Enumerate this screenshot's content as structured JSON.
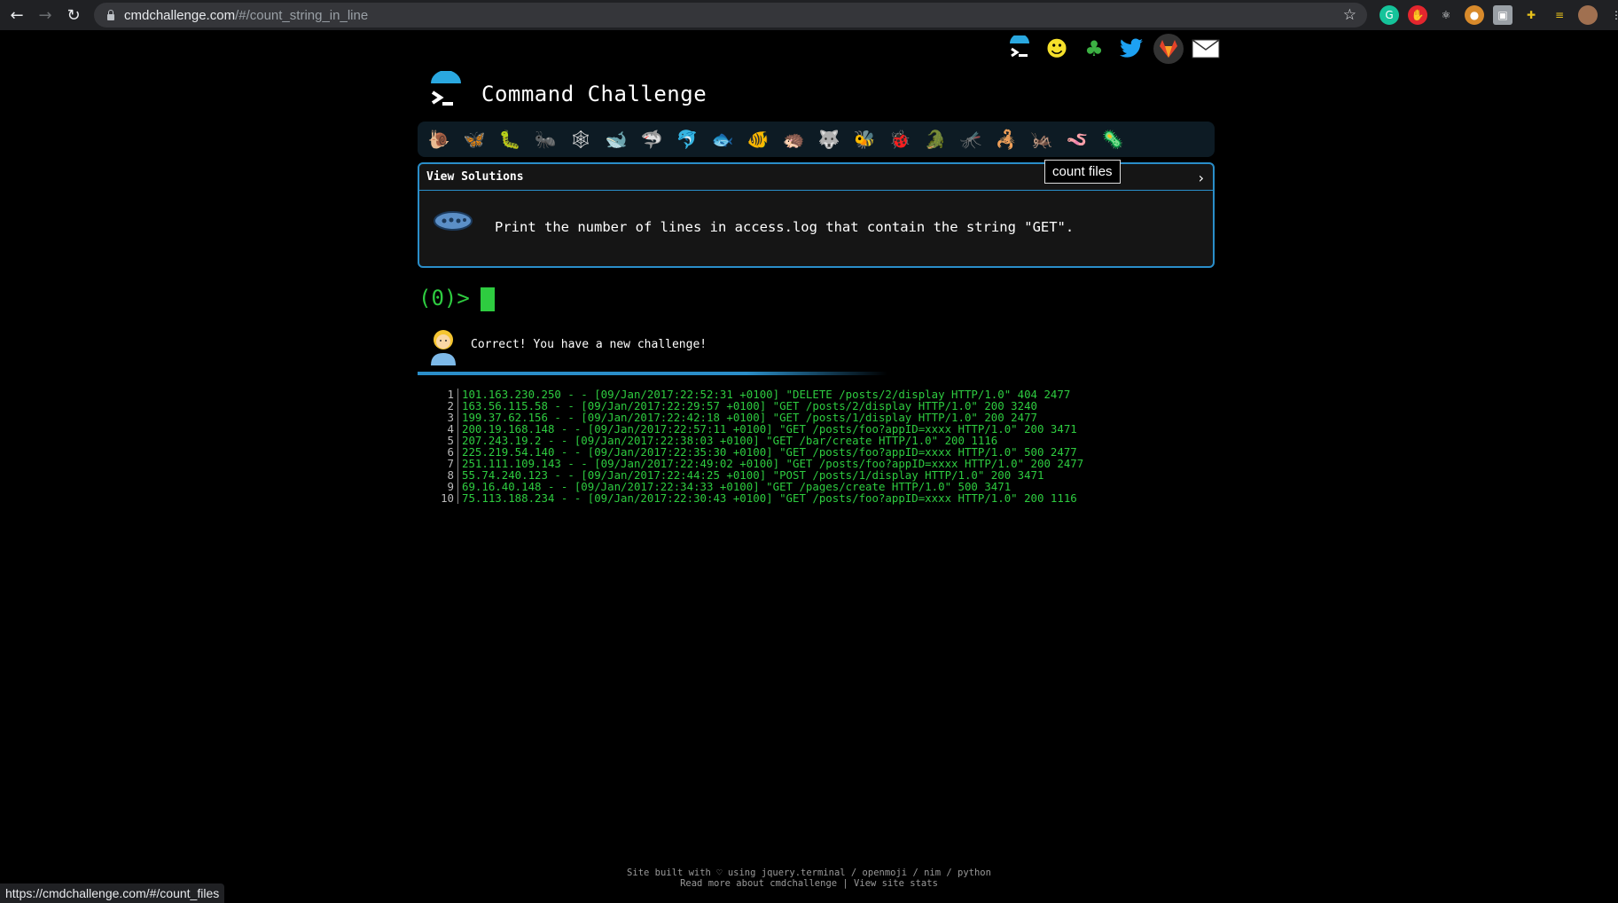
{
  "browser": {
    "url_host": "cmdchallenge.com",
    "url_path": "/#/count_string_in_line",
    "status_url": "https://cmdchallenge.com/#/count_files"
  },
  "app": {
    "title": "Command Challenge",
    "tooltip": "count files"
  },
  "social_icons": [
    "terminal-icon",
    "smiley-icon",
    "tree-icon",
    "twitter-icon",
    "gitlab-icon",
    "mail-icon"
  ],
  "animals": [
    "🐌",
    "🦋",
    "🐛",
    "🐜",
    "🕸",
    "🐋",
    "🦈",
    "🐬",
    "🐟",
    "🐠",
    "🦔",
    "🐺",
    "🐝",
    "🐞",
    "🐊",
    "🦟",
    "🦂",
    "🦗",
    "🪱",
    "🦠"
  ],
  "challenge": {
    "header": "View Solutions",
    "chevron": "›",
    "description": "Print the number of lines in access.log that contain the string \"GET\"."
  },
  "prompt": "(0)>",
  "message": "Correct! You have a new challenge!",
  "log": [
    {
      "n": "1",
      "text": "101.163.230.250 - - [09/Jan/2017:22:52:31 +0100] \"DELETE /posts/2/display HTTP/1.0\" 404 2477"
    },
    {
      "n": "2",
      "text": "163.56.115.58 - - [09/Jan/2017:22:29:57 +0100] \"GET /posts/2/display HTTP/1.0\" 200 3240"
    },
    {
      "n": "3",
      "text": "199.37.62.156 - - [09/Jan/2017:22:42:18 +0100] \"GET /posts/1/display HTTP/1.0\" 200 2477"
    },
    {
      "n": "4",
      "text": "200.19.168.148 - - [09/Jan/2017:22:57:11 +0100] \"GET /posts/foo?appID=xxxx HTTP/1.0\" 200 3471"
    },
    {
      "n": "5",
      "text": "207.243.19.2 - - [09/Jan/2017:22:38:03 +0100] \"GET /bar/create HTTP/1.0\" 200 1116"
    },
    {
      "n": "6",
      "text": "225.219.54.140 - - [09/Jan/2017:22:35:30 +0100] \"GET /posts/foo?appID=xxxx HTTP/1.0\" 500 2477"
    },
    {
      "n": "7",
      "text": "251.111.109.143 - - [09/Jan/2017:22:49:02 +0100] \"GET /posts/foo?appID=xxxx HTTP/1.0\" 200 2477"
    },
    {
      "n": "8",
      "text": "55.74.240.123 - - [09/Jan/2017:22:44:25 +0100] \"POST /posts/1/display HTTP/1.0\" 200 3471"
    },
    {
      "n": "9",
      "text": "69.16.40.148 - - [09/Jan/2017:22:34:33 +0100] \"GET /pages/create HTTP/1.0\" 500 3471"
    },
    {
      "n": "10",
      "text": "75.113.188.234 - - [09/Jan/2017:22:30:43 +0100] \"GET /posts/foo?appID=xxxx HTTP/1.0\" 200 1116"
    }
  ],
  "footer": {
    "line1": "Site built with ♡ using jquery.terminal / openmoji / nim / python",
    "line2": "Read more about cmdchallenge | View site stats"
  },
  "colors": {
    "accent": "#2a8ec9",
    "terminal_green": "#2ecc40"
  }
}
